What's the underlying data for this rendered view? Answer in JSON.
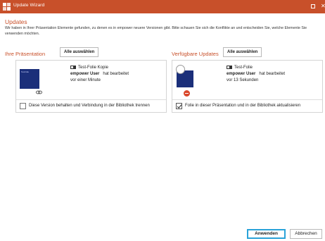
{
  "window": {
    "title": "Update Wizard",
    "accent_color": "#c8502a"
  },
  "header": {
    "heading": "Updates",
    "description": "Wir haben in Ihrer Präsentation Elemente gefunden, zu denen es in empower neuere Versionen gibt. Bitte schauen Sie sich die Konflikte an und entscheiden Sie, welche Elemente Sie verwenden möchten."
  },
  "left": {
    "section_title": "Ihre Präsentation",
    "select_all_label": "Alle auswählen",
    "item": {
      "thumb_text": "Test-Folie",
      "file_name": "Test-Folie Kopie",
      "editor": "empower User",
      "action": "hat bearbeitet",
      "time": "vor einer Minute",
      "option_label": "Diese Version behalten und Verbindung in der Bibliothek trennen",
      "option_checked": false
    }
  },
  "right": {
    "section_title": "Verfügbare Updates",
    "select_all_label": "Alle auswählen",
    "item": {
      "file_name": "Test-Folie",
      "editor": "empower User",
      "action": "hat bearbeitet",
      "time": "vor 13 Sekunden",
      "option_label": "Folie in dieser Präsentation und in der Bibliothek aktualisieren",
      "option_checked": true
    }
  },
  "footer": {
    "apply_label": "Anwenden",
    "cancel_label": "Abbrechen"
  }
}
